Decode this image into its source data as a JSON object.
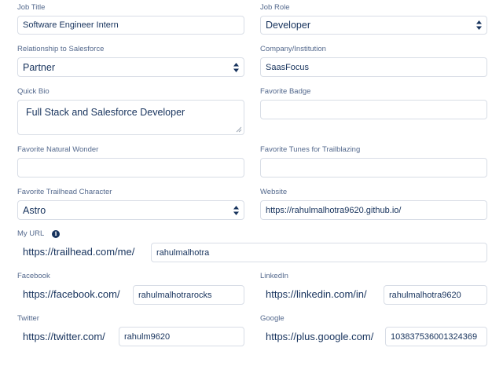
{
  "job_title": {
    "label": "Job Title",
    "value": "Software Engineer Intern"
  },
  "job_role": {
    "label": "Job Role",
    "value": "Developer"
  },
  "relationship": {
    "label": "Relationship to Salesforce",
    "value": "Partner"
  },
  "company": {
    "label": "Company/Institution",
    "value": "SaasFocus"
  },
  "quick_bio": {
    "label": "Quick Bio",
    "value": "Full Stack and Salesforce Developer"
  },
  "favorite_badge": {
    "label": "Favorite Badge",
    "value": ""
  },
  "natural_wonder": {
    "label": "Favorite Natural Wonder",
    "value": ""
  },
  "tunes": {
    "label": "Favorite Tunes for Trailblazing",
    "value": ""
  },
  "trailhead_character": {
    "label": "Favorite Trailhead Character",
    "value": "Astro"
  },
  "website": {
    "label": "Website",
    "value": "https://rahulmalhotra9620.github.io/"
  },
  "my_url": {
    "label": "My URL",
    "info_icon": "info-icon",
    "prefix": "https://trailhead.com/me/",
    "value": "rahulmalhotra"
  },
  "facebook": {
    "label": "Facebook",
    "prefix": "https://facebook.com/",
    "value": "rahulmalhotrarocks"
  },
  "linkedin": {
    "label": "LinkedIn",
    "prefix": "https://linkedin.com/in/",
    "value": "rahulmalhotra9620"
  },
  "twitter": {
    "label": "Twitter",
    "prefix": "https://twitter.com/",
    "value": "rahulm9620"
  },
  "google": {
    "label": "Google",
    "prefix": "https://plus.google.com/",
    "value": "103837536001324369"
  }
}
